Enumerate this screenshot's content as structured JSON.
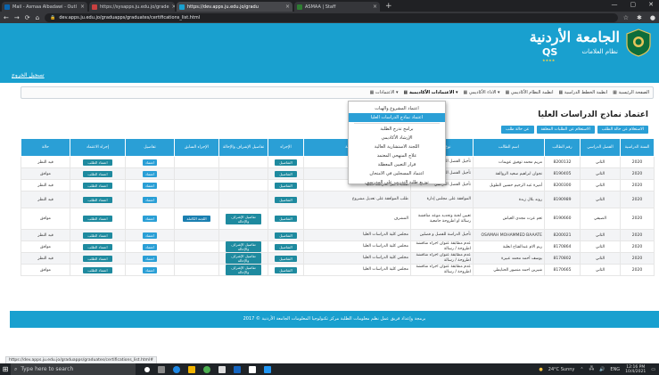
{
  "browser": {
    "tabs": [
      {
        "label": "Mail - Asmaa Albadawi - Outl"
      },
      {
        "label": "https://sysapps.ju.edu.jo/grade"
      },
      {
        "label": "https://dev.apps.ju.edu.jo/gradu"
      },
      {
        "label": "ASMAA | Staff"
      }
    ],
    "new_tab": "+",
    "url": "dev.apps.ju.edu.jo/graduapps/graduates/certifications_list.html",
    "secure_label": "dev.apps.ju.edu.jo"
  },
  "header": {
    "title": "الجامعة الأردنية",
    "subtitle": "نظام العلامات",
    "qs_logo": "QS",
    "qs_stars": "★★★★",
    "logout": "تسجيل الخروج"
  },
  "nav": {
    "items": [
      "الصفحة الرئيسية",
      "انظمة الخطط الدراسية",
      "انظمة النظام الأكاديمي",
      "الاداء الأكاديمي",
      "الاعتمادات الأكاديمية",
      "الاعتمادات"
    ],
    "active_index": 4
  },
  "dropdown": {
    "items": [
      "اعتماد المشروع والهبات",
      "اعتماد نماذج الدراسات العليا",
      "برامج تدرج الطلبة",
      "الإرشاد الأكاديمي",
      "اللجنة الاستشارية العالية",
      "علاج المنهجي المعتمد",
      "قرار التعيين المعطلة",
      "اعتماد المسجلين في الامتحان",
      "توزيع طلبة التدريب على المدرسين",
      "متابعة تدريب الطلبة"
    ],
    "highlighted_index": 1
  },
  "page": {
    "title": "اعتماد نماذج الدراسات العليا",
    "filters": [
      "الاستعلام عن حالة الطلب",
      "الاستعلام عن الطلبات المعلقة",
      "عن حالة طلب"
    ]
  },
  "table": {
    "headers": [
      "السنة الدراسية",
      "الفصل الدراسي",
      "رقم الطالب",
      "اسم الطالب",
      "نوع الطلب",
      "عنوان الرسالة",
      "الإجراء",
      "تفاصيل الإشراف والإحالة",
      "الإجراء السابق",
      "تفاصيل",
      "إجراء الاعتماد",
      "حالة"
    ],
    "rows": [
      {
        "year": "2020",
        "sem": "الثاني",
        "id": "8200132",
        "name": "مريم محمد توفيق عويمات",
        "type": "تأجيل الفصل الدراسي",
        "topic": "طلب تأجيل الدراسة العليا",
        "action": "التفاصيل",
        "super": "",
        "prev": "",
        "det": "اعتماد",
        "approve": "اعتماد الطلب",
        "status": "قيد النظر"
      },
      {
        "year": "2020",
        "sem": "الثاني",
        "id": "8190405",
        "name": "نجوان ابراهيم سعيد الروالفة",
        "type": "تأجيل الفصل الدراسي",
        "topic": "طلب تأجيل الدراسة العليا",
        "action": "التفاصيل",
        "super": "",
        "prev": "",
        "det": "اعتماد",
        "approve": "اعتماد الطلب",
        "status": "موافق"
      },
      {
        "year": "2020",
        "sem": "الثاني",
        "id": "8200300",
        "name": "أميرة عبد الرحيم حسين الطويل",
        "type": "تأجيل الفصل الدراسي",
        "topic": "طلب تأجيل الدراسة العليا",
        "action": "التفاصيل",
        "super": "",
        "prev": "",
        "det": "اعتماد",
        "approve": "اعتماد الطلب",
        "status": "قيد النظر"
      },
      {
        "year": "2020",
        "sem": "الثاني",
        "id": "8190989",
        "name": "روند بلال زبدة",
        "type": "الموافقة على مجلس إدارة",
        "topic": "طلب الموافقة على تعديل مشروع",
        "action": "التفاصيل",
        "super": "",
        "prev": "",
        "det": "اعتماد",
        "approve": "اعتماد الطلب",
        "status": "قيد النظر"
      },
      {
        "year": "2020",
        "sem": "الصيفي",
        "id": "8190660",
        "name": "تغم عزت مجدي العياش",
        "type": "تعيين لجنة وتحديد موعد مناقشة رسالة او اطروحة جامعية",
        "topic": "المشرف",
        "action": "التفاصيل",
        "super": "تفاصيل الإشراف والإحالة",
        "prev": "اللجنة الكاملة",
        "det": "اعتماد",
        "approve": "اعتماد الطلب",
        "status": "موافق"
      },
      {
        "year": "2020",
        "sem": "الثاني",
        "id": "8200021",
        "name": "OSAMAH MOHAMMED BAAATE",
        "type": "تأجيل الدراسة للفصل و فصلين",
        "topic": "مجلس كلية الدراسات العليا",
        "action": "التفاصيل",
        "super": "",
        "prev": "",
        "det": "اعتماد",
        "approve": "اعتماد الطلب",
        "status": "قيد النظر"
      },
      {
        "year": "2020",
        "sem": "الثاني",
        "id": "8170864",
        "name": "ريم الام عبدالفتاح ابعلية",
        "type": "عدم مطابقة عنوان اجراء مناقشة اطروحة / رسالة",
        "topic": "مجلس كلية الدراسات العليا",
        "action": "التفاصيل",
        "super": "تفاصيل الإشراف والإحالة",
        "prev": "",
        "det": "اعتماد",
        "approve": "اعتماد الطلب",
        "status": "موافق"
      },
      {
        "year": "2020",
        "sem": "الثاني",
        "id": "8170802",
        "name": "يوسف أحمد محمد عبيرة",
        "type": "عدم مطابقة عنوان اجراء مناقشة اطروحة / رسالة",
        "topic": "مجلس كلية الدراسات العليا",
        "action": "التفاصيل",
        "super": "تفاصيل الإشراف والإحالة",
        "prev": "",
        "det": "اعتماد",
        "approve": "اعتماد الطلب",
        "status": "قيد النظر"
      },
      {
        "year": "2020",
        "sem": "الثاني",
        "id": "8170665",
        "name": "شيرين احمد منصور الحنايطي",
        "type": "عدم مطابقة عنوان اجراء مناقشة اطروحة / رسالة",
        "topic": "مجلس كلية الدراسات العليا",
        "action": "التفاصيل",
        "super": "تفاصيل الإشراف والإحالة",
        "prev": "",
        "det": "اعتماد",
        "approve": "اعتماد الطلب",
        "status": "موافق"
      }
    ]
  },
  "footer": {
    "text": "برمجة وإعداد فريق عمل نظم معلومات الطلبة مركز تكنولوجيا المعلومات الجامعة الأردنية © 2017"
  },
  "status_bar": {
    "url": "https://dev.apps.ju.edu.jo/graduapps/graduates/certifications_list.html#"
  },
  "taskbar": {
    "search": "Type here to search",
    "weather": "24°C Sunny",
    "lang": "ENG",
    "time": "12:16 PM",
    "date": "10/4/2021"
  }
}
